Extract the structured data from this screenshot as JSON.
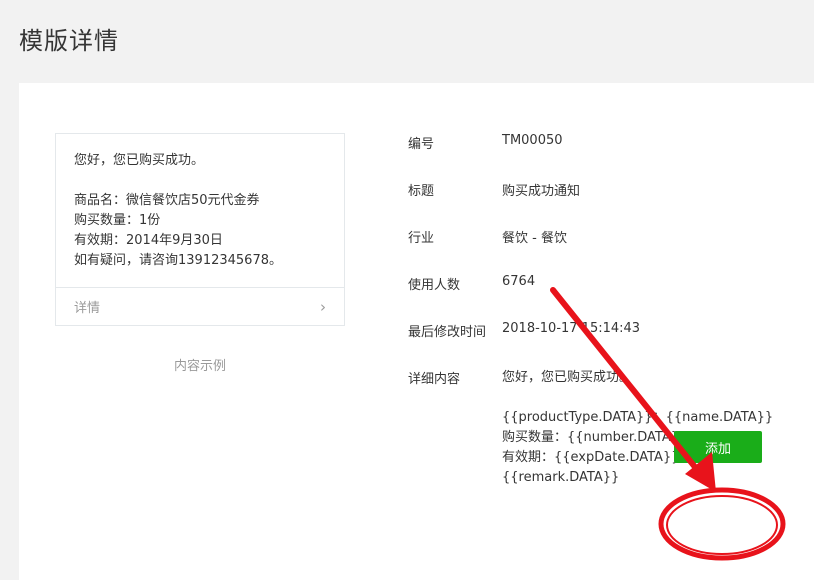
{
  "page": {
    "title": "模版详情"
  },
  "preview": {
    "greeting": "您好，您已购买成功。",
    "lines": [
      "商品名：微信餐饮店50元代金券",
      "购买数量：1份",
      "有效期：2014年9月30日",
      "如有疑问，请咨询13912345678。"
    ],
    "detail_label": "详情",
    "caption": "内容示例"
  },
  "info": {
    "number_label": "编号",
    "number_value": "TM00050",
    "title_label": "标题",
    "title_value": "购买成功通知",
    "industry_label": "行业",
    "industry_value": "餐饮 - 餐饮",
    "users_label": "使用人数",
    "users_value": "6764",
    "modified_label": "最后修改时间",
    "modified_value": "2018-10-17 15:14:43",
    "content_label": "详细内容",
    "content_greeting": "您好，您已购买成功。",
    "content_lines": [
      "{{productType.DATA}}：{{name.DATA}}",
      "购买数量：{{number.DATA}}",
      "有效期：{{expDate.DATA}}",
      "{{remark.DATA}}"
    ]
  },
  "actions": {
    "add_label": "添加"
  },
  "annotation": {
    "color": "#e8131b"
  }
}
